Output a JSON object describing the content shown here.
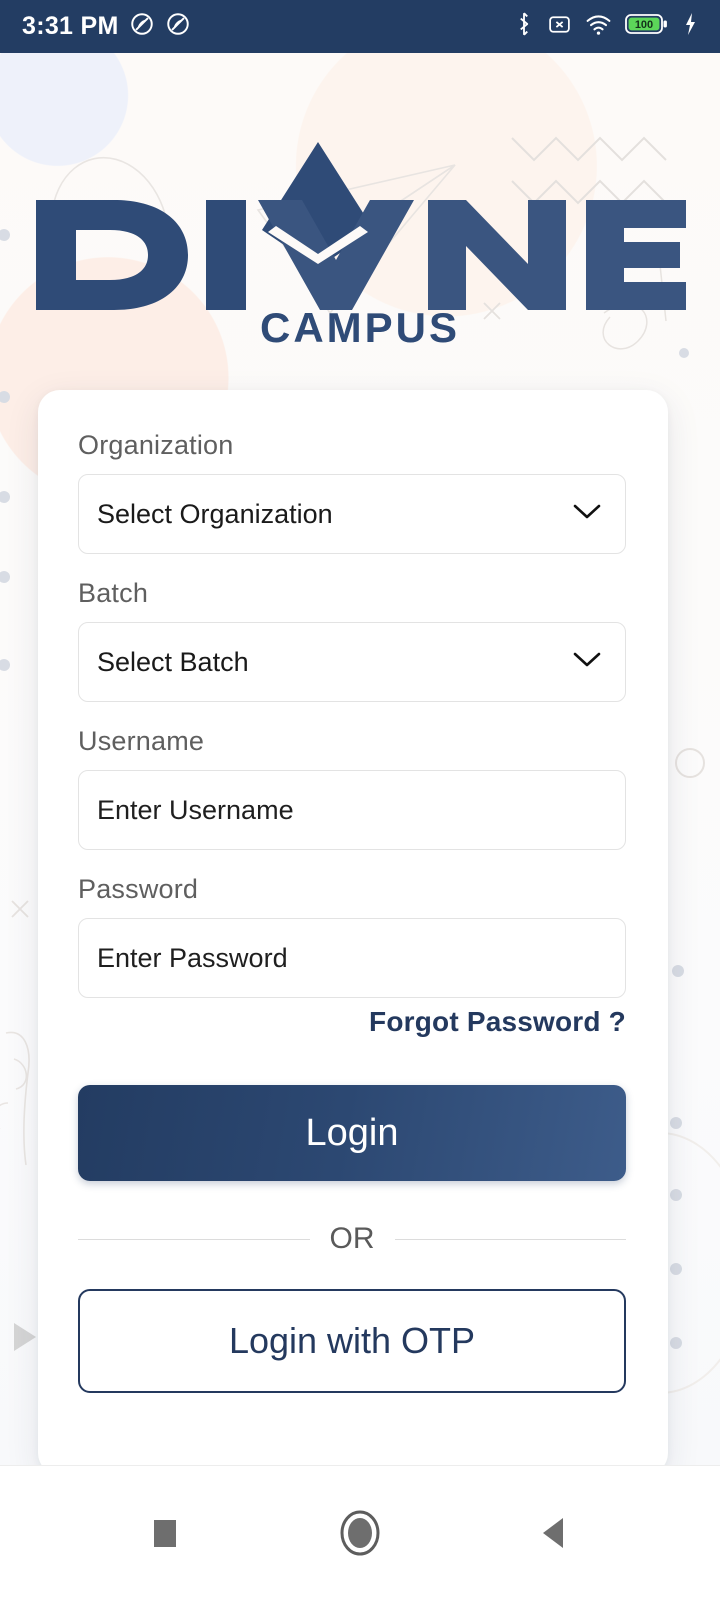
{
  "status_bar": {
    "time": "3:31 PM",
    "left_icons": [
      "dnd-icon",
      "dnd-icon"
    ],
    "right_icons": [
      "bluetooth-icon",
      "no-sim-icon",
      "wifi-icon",
      "battery-icon",
      "charging-bolt-icon"
    ],
    "battery_level": "100",
    "background_color": "#233d63"
  },
  "brand": {
    "name": "DIVINE",
    "subtitle": "CAMPUS",
    "logo_icon": "divine-diamond-logo",
    "color": "#2f4b77"
  },
  "form": {
    "organization": {
      "label": "Organization",
      "value": "Select Organization",
      "icon": "chevron-down-icon"
    },
    "batch": {
      "label": "Batch",
      "value": "Select Batch",
      "icon": "chevron-down-icon"
    },
    "username": {
      "label": "Username",
      "placeholder": "Enter Username",
      "value": ""
    },
    "password": {
      "label": "Password",
      "placeholder": "Enter Password",
      "value": ""
    },
    "forgot_password": "Forgot Password ?",
    "login_button": "Login",
    "divider_text": "OR",
    "otp_button": "Login with OTP",
    "accent_color": "#24395e"
  },
  "nav_bar": {
    "recents": "recents-square-icon",
    "home": "home-circle-icon",
    "back": "back-triangle-icon"
  }
}
